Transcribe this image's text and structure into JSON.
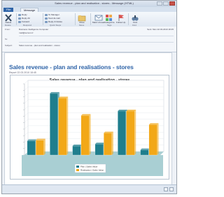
{
  "window": {
    "title": "Sales revenue - plan and realisation - stores - Message (HTML)"
  },
  "ribbon": {
    "tabs": [
      {
        "label": "File"
      },
      {
        "label": "Message"
      }
    ],
    "groups": {
      "delete": {
        "delete_label": "Delete",
        "group_label": "Delete"
      },
      "respond": {
        "reply": "Reply",
        "reply_all": "Reply All",
        "forward": "Forward",
        "group_label": "Respond"
      },
      "quick_steps": {
        "move_to": "To Manager",
        "team_email": "Team E-mail",
        "reply_delete": "Reply & Delete",
        "group_label": "Quick Steps"
      },
      "move": {
        "move_label": "Move",
        "group_label": "Move"
      },
      "tags": {
        "mark_unread": "Mark Unread",
        "categorize": "Categorize",
        "follow_up": "Follow Up",
        "group_label": "Tags"
      },
      "find": {
        "find_label": "Find",
        "group_label": "Find"
      }
    }
  },
  "header": {
    "from_key": "From:",
    "from_value": "Business Intelligence Computer",
    "from_addr": "mail@server.cz",
    "sent_value": "Sent:  Mon 22.03.2010 18:45",
    "to_key": "To:",
    "to_value": "",
    "subject_key": "Subject:",
    "subject_value": "Sales revenue - plan and realisation - stores"
  },
  "report": {
    "title": "Sales revenue - plan and realisations - stores",
    "subtitle": "Report 22.03.2010 18:45"
  },
  "colors": {
    "plan": "#1f7e8d",
    "realisation": "#f2a818",
    "floor": "#a9cfd3",
    "accent": "#2f64a8"
  },
  "chart_data": {
    "type": "bar",
    "title": "Sales revenue - plan and realisation - stores",
    "categories": [
      "",
      "",
      "",
      "",
      "",
      ""
    ],
    "series": [
      {
        "name": "Plan | Sales Value",
        "values": [
          22,
          95,
          14,
          17,
          68,
          8
        ]
      },
      {
        "name": "Realisation | Sales Value",
        "values": [
          23,
          88,
          61,
          34,
          68,
          47
        ]
      }
    ],
    "ylim": [
      0,
      110
    ],
    "grid": true,
    "legend": "bottom"
  }
}
